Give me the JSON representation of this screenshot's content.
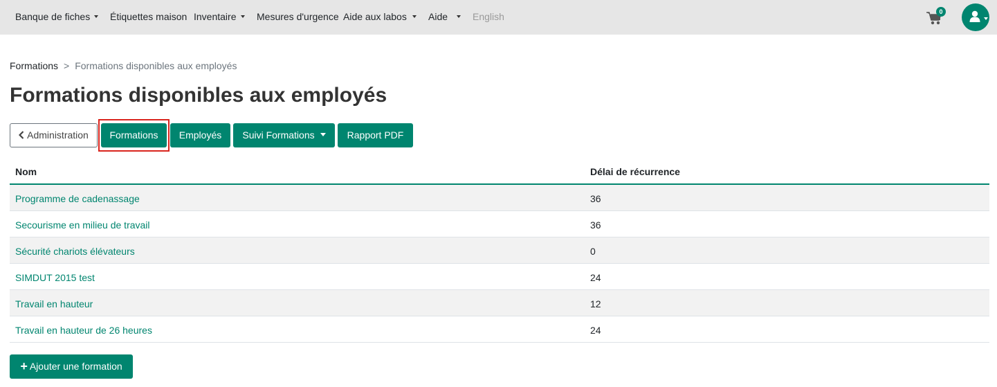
{
  "nav": {
    "items": [
      {
        "label": "Banque de fiches",
        "has_caret": true
      },
      {
        "label": "Étiquettes maison",
        "has_caret": false
      },
      {
        "label": "Inventaire",
        "has_caret": true
      },
      {
        "label": "Mesures d'urgence",
        "has_caret": false
      },
      {
        "label": "Aide aux labos",
        "has_caret": true
      },
      {
        "label": "Aide",
        "has_caret": true
      },
      {
        "label": "English",
        "has_caret": false
      }
    ],
    "cart_count": "0",
    "cart_icon": "shopping-cart-icon",
    "user_icon": "user-icon"
  },
  "breadcrumb": {
    "parent": "Formations",
    "separator": ">",
    "current": "Formations disponibles aux employés"
  },
  "page_title": "Formations disponibles aux employés",
  "buttons": {
    "back": "Administration",
    "formations": "Formations",
    "employes": "Employés",
    "suivi": "Suivi Formations",
    "rapport": "Rapport PDF"
  },
  "table": {
    "headers": [
      "Nom",
      "Délai de récurrence"
    ],
    "rows": [
      {
        "name": "Programme de cadenassage",
        "delay": "36"
      },
      {
        "name": "Secourisme en milieu de travail",
        "delay": "36"
      },
      {
        "name": "Sécurité chariots élévateurs",
        "delay": "0"
      },
      {
        "name": "SIMDUT 2015 test",
        "delay": "24"
      },
      {
        "name": "Travail en hauteur",
        "delay": "12"
      },
      {
        "name": "Travail en hauteur de 26 heures",
        "delay": "24"
      }
    ]
  },
  "add_button": "Ajouter une formation",
  "colors": {
    "accent": "#00856f",
    "highlight": "#d9251d",
    "navbar": "#e6e6e6"
  }
}
